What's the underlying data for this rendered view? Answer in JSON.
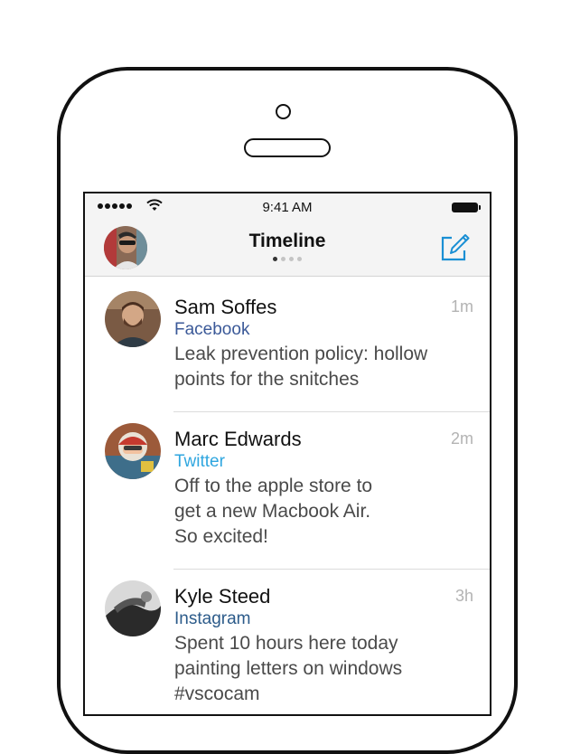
{
  "status_bar": {
    "time": "9:41 AM"
  },
  "navbar": {
    "title": "Timeline"
  },
  "colors": {
    "facebook": "#3b5998",
    "twitter": "#2fa6df",
    "instagram": "#2c5b8a",
    "compose": "#1a8fd4"
  },
  "posts": [
    {
      "name": "Sam Soffes",
      "time": "1m",
      "source": "Facebook",
      "text": "Leak prevention policy: hollow\npoints for the snitches"
    },
    {
      "name": "Marc Edwards",
      "time": "2m",
      "source": "Twitter",
      "text": "Off to the apple store to\nget a new Macbook Air.\nSo excited!"
    },
    {
      "name": "Kyle Steed",
      "time": "3h",
      "source": "Instagram",
      "text": "Spent 10 hours here today\npainting letters on windows\n#vscocam"
    }
  ]
}
